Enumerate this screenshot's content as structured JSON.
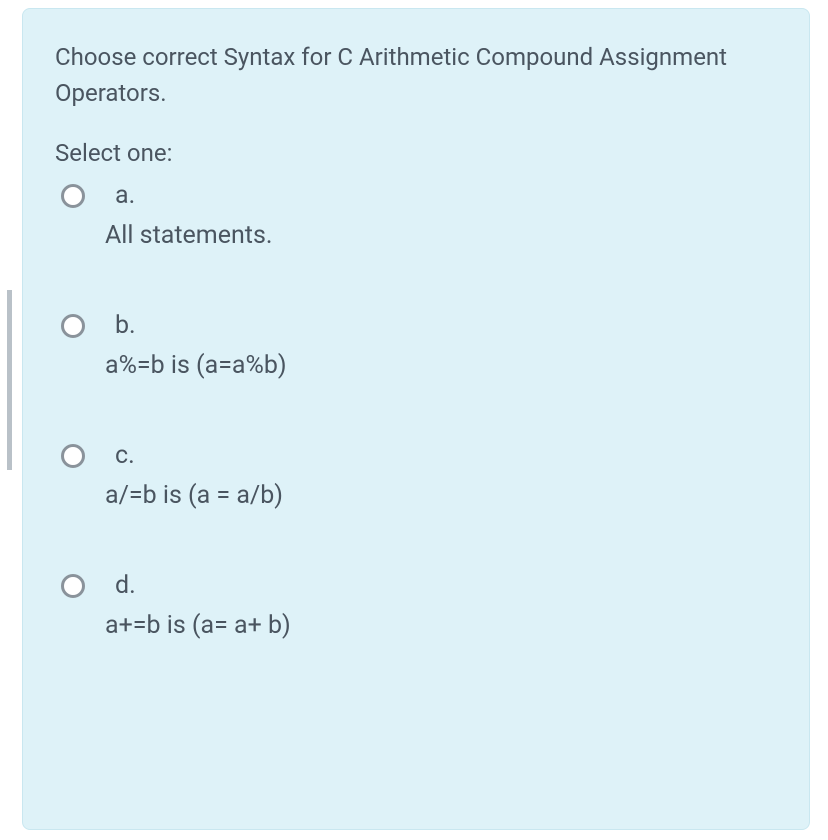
{
  "question": {
    "text": "Choose correct Syntax for C Arithmetic Compound Assignment Operators.",
    "select_label": "Select one:",
    "options": [
      {
        "letter": "a.",
        "text": "All statements."
      },
      {
        "letter": "b.",
        "text": "a%=b is (a=a%b)"
      },
      {
        "letter": "c.",
        "text": "a/=b is (a = a/b)"
      },
      {
        "letter": "d.",
        "text": "a+=b is (a= a+ b)"
      }
    ]
  }
}
